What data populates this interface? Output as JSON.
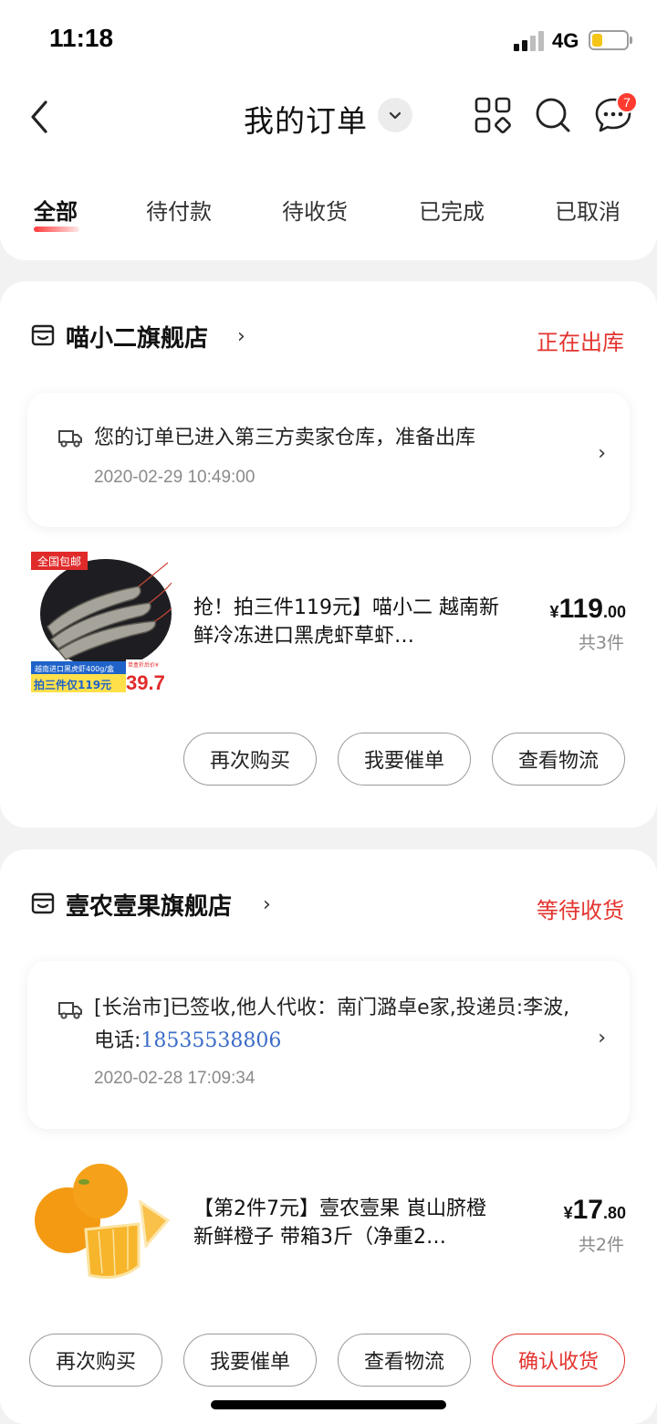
{
  "status_bar": {
    "time": "11:18",
    "network": "4G"
  },
  "header": {
    "title": "我的订单",
    "message_badge": "7"
  },
  "tabs": [
    {
      "label": "全部",
      "active": true
    },
    {
      "label": "待付款",
      "active": false
    },
    {
      "label": "待收货",
      "active": false
    },
    {
      "label": "已完成",
      "active": false
    },
    {
      "label": "已取消",
      "active": false
    }
  ],
  "orders": [
    {
      "store": "喵小二旗舰店",
      "status": "正在出库",
      "logistics": {
        "text": "您的订单已进入第三方卖家仓库，准备出库",
        "time": "2020-02-29 10:49:00"
      },
      "product": {
        "title": "抢！拍三件119元】喵小二 越南新鲜冷冻进口黑虎虾草虾…",
        "price_yen": "¥",
        "price_int": "119",
        "price_dec": ".00",
        "qty": "共3件",
        "thumb_tag": "全国包邮",
        "thumb_caption": "越南进口黑虎虾400g/盒",
        "thumb_promo": "拍三件仅119元",
        "thumb_unit_label": "单盒折后价¥",
        "thumb_price": "39.7"
      },
      "buttons": [
        "再次购买",
        "我要催单",
        "查看物流"
      ]
    },
    {
      "store": "壹农壹果旗舰店",
      "status": "等待收货",
      "logistics": {
        "text_prefix": "[长治市]已签收,他人代收：南门潞卓e家,投递员:李波,电话:",
        "phone": "18535538806",
        "time": "2020-02-28 17:09:34"
      },
      "product": {
        "title": "【第2件7元】壹农壹果 崀山脐橙  新鲜橙子 带箱3斤（净重2…",
        "price_yen": "¥",
        "price_int": "17",
        "price_dec": ".80",
        "qty": "共2件"
      },
      "buttons": [
        "再次购买",
        "我要催单",
        "查看物流",
        "确认收货"
      ]
    }
  ],
  "colors": {
    "accent": "#e3342f",
    "link": "#3b6cc8",
    "background": "#f2f2f2"
  }
}
